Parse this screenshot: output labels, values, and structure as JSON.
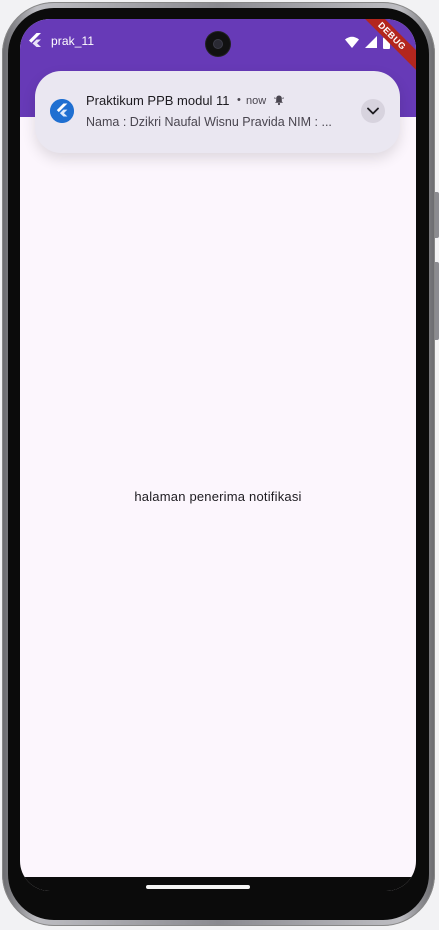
{
  "status_bar": {
    "app_title": "prak_11",
    "debug_banner": "DEBUG",
    "icons": [
      "flutter-icon",
      "wifi-icon",
      "signal-icon",
      "battery-icon"
    ]
  },
  "app_bar": {
    "color": "#673ab7"
  },
  "notification": {
    "icon": "flutter-icon",
    "title": "Praktikum PPB modul 11",
    "separator": "•",
    "time": "now",
    "alert_icon": "bell-icon",
    "body": "Nama : Dzikri Naufal Wisnu Pravida NIM : ...",
    "expand_icon": "chevron-down-icon"
  },
  "body": {
    "center_text": "halaman penerima notifikasi",
    "background": "#fcf6fd"
  }
}
